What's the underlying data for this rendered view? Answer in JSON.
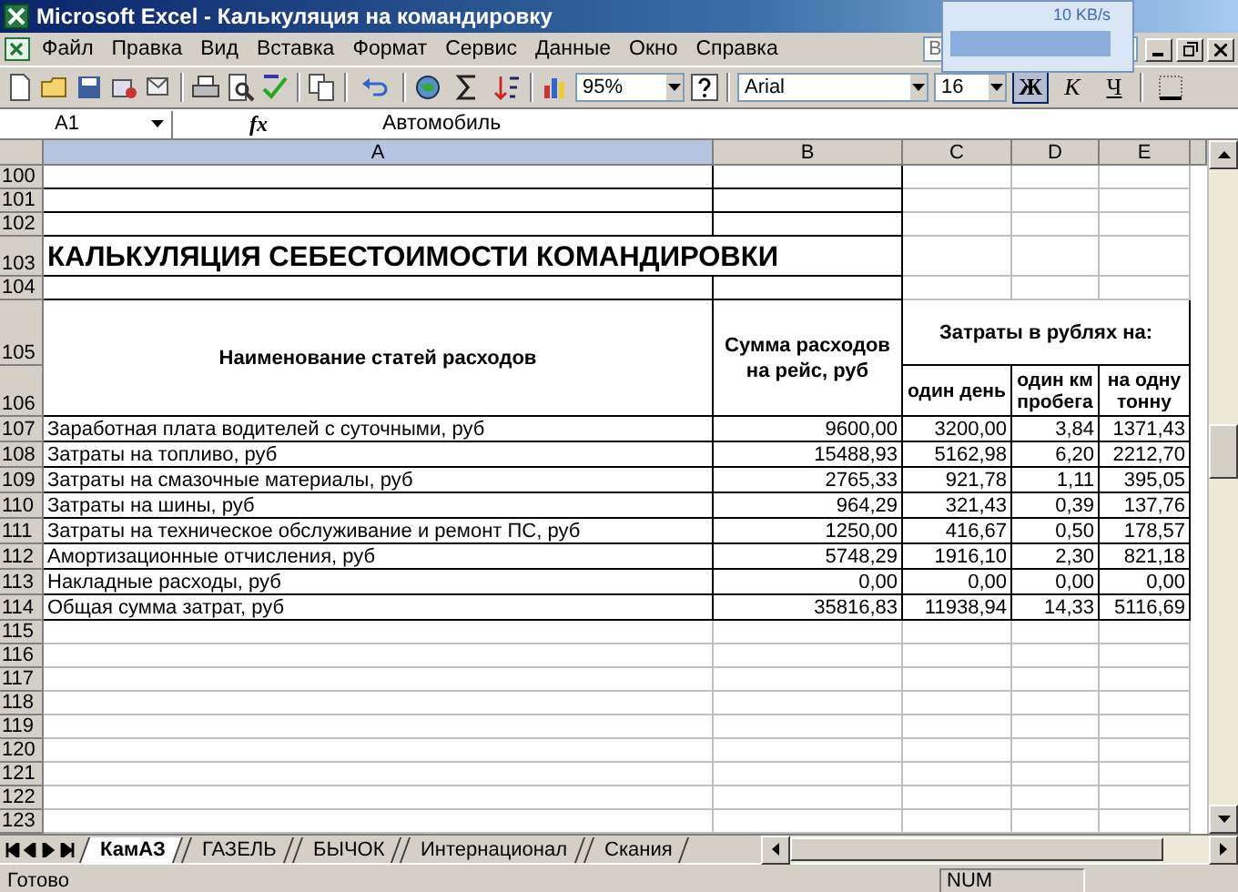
{
  "window": {
    "title": "Microsoft Excel - Калькуляция на командировку"
  },
  "network_meter": {
    "reading": "10 KB/s"
  },
  "menu": [
    "Файл",
    "Правка",
    "Вид",
    "Вставка",
    "Формат",
    "Сервис",
    "Данные",
    "Окно",
    "Справка"
  ],
  "question_field": {
    "placeholder": "В"
  },
  "toolbar": {
    "zoom": "95%",
    "font": "Arial",
    "size": "16",
    "format_buttons": [
      {
        "label": "Ж",
        "selected": true
      },
      {
        "label": "К",
        "selected": false
      },
      {
        "label": "Ч",
        "selected": false
      }
    ]
  },
  "formula_bar": {
    "name_box": "A1",
    "fx": "fx",
    "value": "Автомобиль"
  },
  "columns": [
    {
      "label": "A",
      "selected": true
    },
    {
      "label": "B",
      "selected": false
    },
    {
      "label": "C",
      "selected": false
    },
    {
      "label": "D",
      "selected": false
    },
    {
      "label": "E",
      "selected": false
    }
  ],
  "row_numbers": [
    "100",
    "101",
    "102",
    "103",
    "104",
    "105",
    "106",
    "107",
    "108",
    "109",
    "110",
    "111",
    "112",
    "113",
    "114",
    "115",
    "116",
    "117",
    "118",
    "119",
    "120",
    "121",
    "122",
    "123"
  ],
  "sheet": {
    "title": "КАЛЬКУЛЯЦИЯ СЕБЕСТОИМОСТИ КОМАНДИРОВКИ",
    "header": {
      "name": "Наименование статей расходов",
      "sum": "Сумма расходов на рейс, руб",
      "costs_per": "Затраты в рублях на:",
      "sub": [
        "один день",
        "один км пробега",
        "на одну тонну"
      ]
    },
    "items": [
      {
        "name": "Заработная плата водителей с суточными, руб",
        "values": [
          "9600,00",
          "3200,00",
          "3,84",
          "1371,43"
        ]
      },
      {
        "name": "Затраты на топливо, руб",
        "values": [
          "15488,93",
          "5162,98",
          "6,20",
          "2212,70"
        ]
      },
      {
        "name": "Затраты на смазочные материалы, руб",
        "values": [
          "2765,33",
          "921,78",
          "1,11",
          "395,05"
        ]
      },
      {
        "name": "Затраты на шины, руб",
        "values": [
          "964,29",
          "321,43",
          "0,39",
          "137,76"
        ]
      },
      {
        "name": "Затраты на техническое обслуживание и ремонт ПС, руб",
        "values": [
          "1250,00",
          "416,67",
          "0,50",
          "178,57"
        ]
      },
      {
        "name": "Амортизационные отчисления, руб",
        "values": [
          "5748,29",
          "1916,10",
          "2,30",
          "821,18"
        ]
      },
      {
        "name": "Накладные расходы, руб",
        "values": [
          "0,00",
          "0,00",
          "0,00",
          "0,00"
        ]
      },
      {
        "name": "Общая сумма затрат, руб",
        "values": [
          "35816,83",
          "11938,94",
          "14,33",
          "5116,69"
        ]
      }
    ]
  },
  "sheet_tabs": [
    {
      "label": "КамАЗ",
      "selected": true
    },
    {
      "label": "ГАЗЕЛЬ",
      "selected": false
    },
    {
      "label": "БЫЧОК",
      "selected": false
    },
    {
      "label": "Интернационал",
      "selected": false
    },
    {
      "label": "Скания",
      "selected": false
    }
  ],
  "status_bar": {
    "left": "Готово",
    "mode": "NUM"
  }
}
